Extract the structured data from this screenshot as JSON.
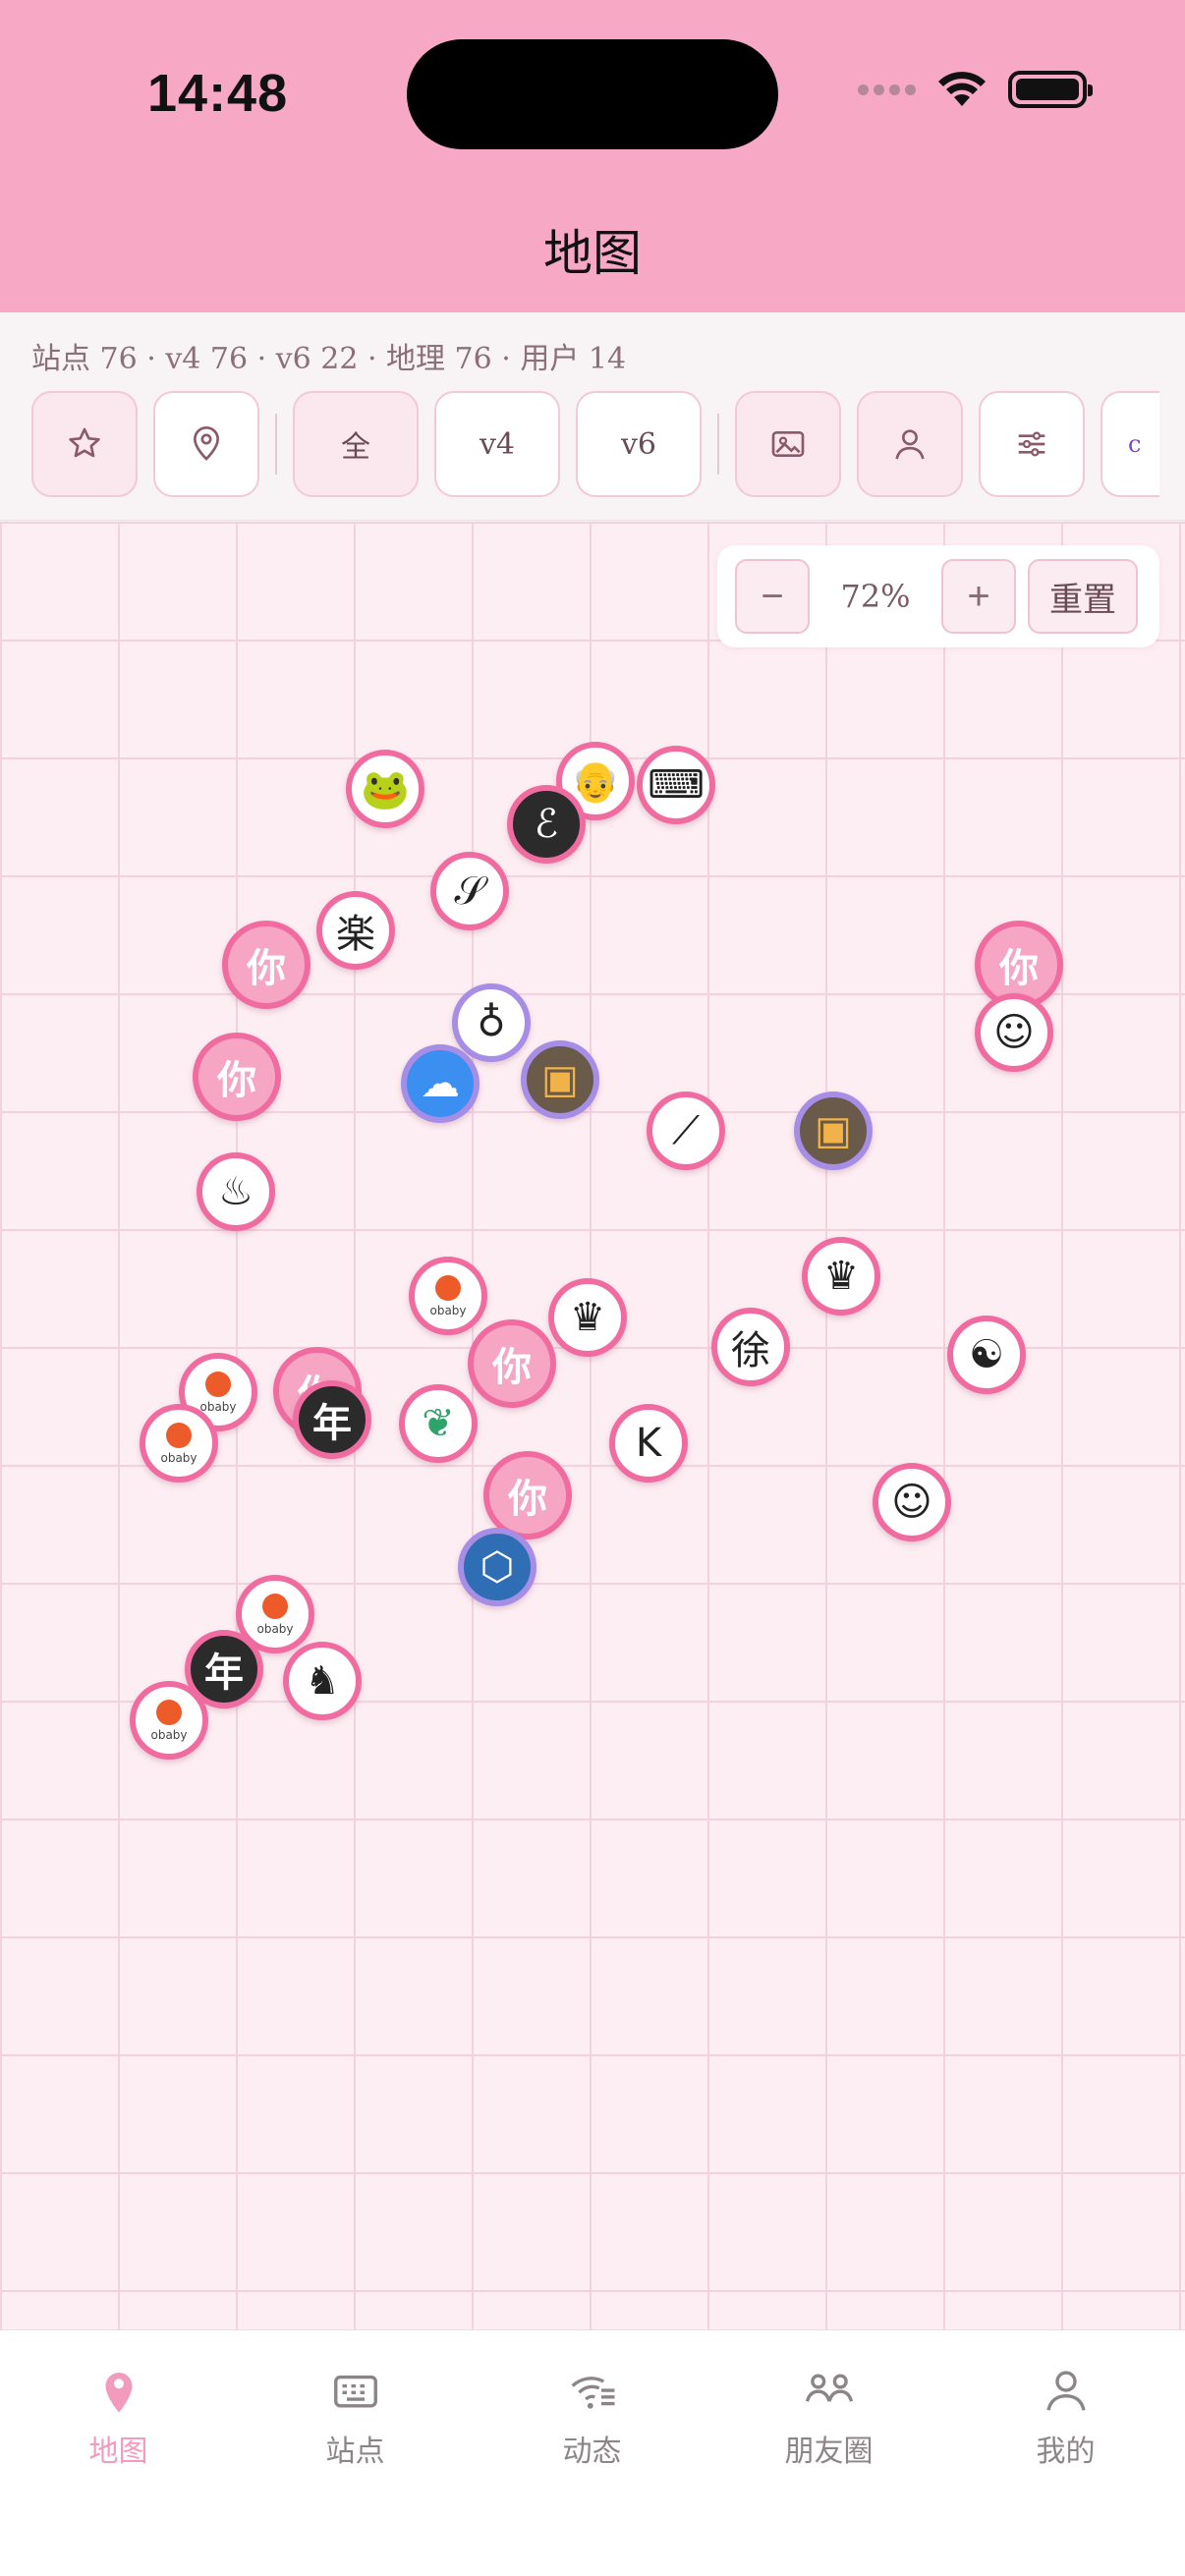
{
  "status_bar": {
    "time": "14:48"
  },
  "header": {
    "title": "地图"
  },
  "stats": {
    "text": "站点 76 · v4 76 · v6 22 · 地理 76 · 用户 14"
  },
  "filters": {
    "favorite_icon": "star-icon",
    "location_icon": "map-pin-icon",
    "all": "全",
    "v4": "v4",
    "v6": "v6",
    "image_icon": "image-icon",
    "user_icon": "user-icon",
    "settings_icon": "sliders-icon",
    "cut_chip": "c"
  },
  "zoom": {
    "minus": "−",
    "level": "72%",
    "plus": "+",
    "reset": "重置"
  },
  "markers": [
    {
      "label": "",
      "kind": "frog"
    },
    {
      "label": "",
      "kind": "man"
    },
    {
      "label": "",
      "kind": "typewriter"
    },
    {
      "label": "",
      "kind": "script-e"
    },
    {
      "label": "",
      "kind": "s-letter"
    },
    {
      "label": "楽",
      "kind": "kanji"
    },
    {
      "label": "你",
      "kind": "ni"
    },
    {
      "label": "你",
      "kind": "ni"
    },
    {
      "label": "",
      "kind": "anime"
    },
    {
      "label": "",
      "kind": "bag"
    },
    {
      "label": "你",
      "kind": "ni"
    },
    {
      "label": "",
      "kind": "cloud"
    },
    {
      "label": "",
      "kind": "photo"
    },
    {
      "label": "",
      "kind": "leek"
    },
    {
      "label": "",
      "kind": "photo"
    },
    {
      "label": "",
      "kind": "icecream"
    },
    {
      "label": "",
      "kind": "crown"
    },
    {
      "label": "",
      "kind": "crown"
    },
    {
      "label": "徐",
      "kind": "kanji"
    },
    {
      "label": "",
      "kind": "yinyang"
    },
    {
      "label": "",
      "kind": "obaby"
    },
    {
      "label": "",
      "kind": "obaby"
    },
    {
      "label": "你",
      "kind": "ni"
    },
    {
      "label": "你",
      "kind": "ni"
    },
    {
      "label": "年",
      "kind": "nian"
    },
    {
      "label": "",
      "kind": "leaf"
    },
    {
      "label": "",
      "kind": "obaby"
    },
    {
      "label": "K",
      "kind": "letter"
    },
    {
      "label": "你",
      "kind": "ni"
    },
    {
      "label": "",
      "kind": "hex"
    },
    {
      "label": "",
      "kind": "face"
    },
    {
      "label": "",
      "kind": "obaby"
    },
    {
      "label": "年",
      "kind": "nian"
    },
    {
      "label": "",
      "kind": "raccoon"
    },
    {
      "label": "",
      "kind": "obaby"
    }
  ],
  "obaby_text": "obaby",
  "tabs": [
    {
      "label": "地图",
      "icon": "map-pin-icon",
      "active": true
    },
    {
      "label": "站点",
      "icon": "keyboard-icon",
      "active": false
    },
    {
      "label": "动态",
      "icon": "wifi-list-icon",
      "active": false
    },
    {
      "label": "朋友圈",
      "icon": "friends-icon",
      "active": false
    },
    {
      "label": "我的",
      "icon": "profile-icon",
      "active": false
    }
  ],
  "colors": {
    "header": "#f7a8c4",
    "accent": "#f06ca0",
    "v6": "#a68de6",
    "active_tab": "#f39bbd"
  }
}
